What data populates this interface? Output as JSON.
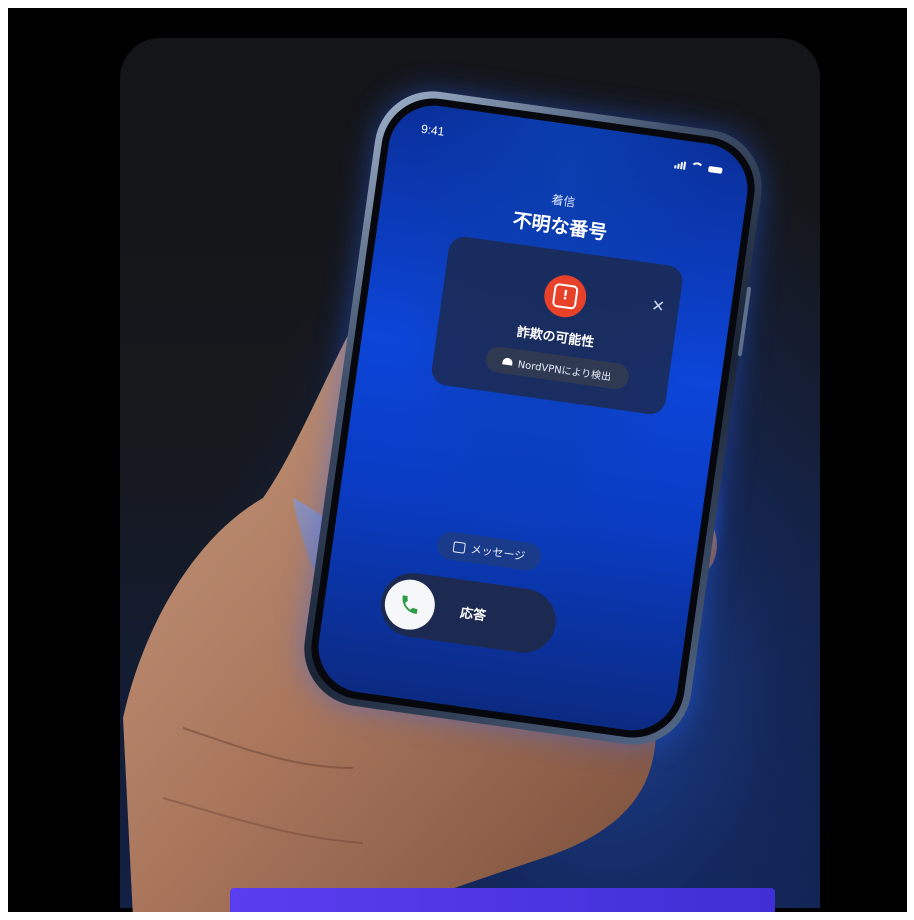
{
  "status_bar": {
    "time": "9:41"
  },
  "incoming": {
    "label": "着信",
    "caller": "不明な番号"
  },
  "alert": {
    "title": "詐欺の可能性",
    "detected_by": "NordVPNにより検出",
    "icon": "warning-octagon-icon",
    "close_icon": "close-icon",
    "accent": "#E8412A"
  },
  "actions": {
    "message_label": "メッセージ",
    "answer_label": "応答",
    "answer_icon_color": "#2E9B47"
  }
}
